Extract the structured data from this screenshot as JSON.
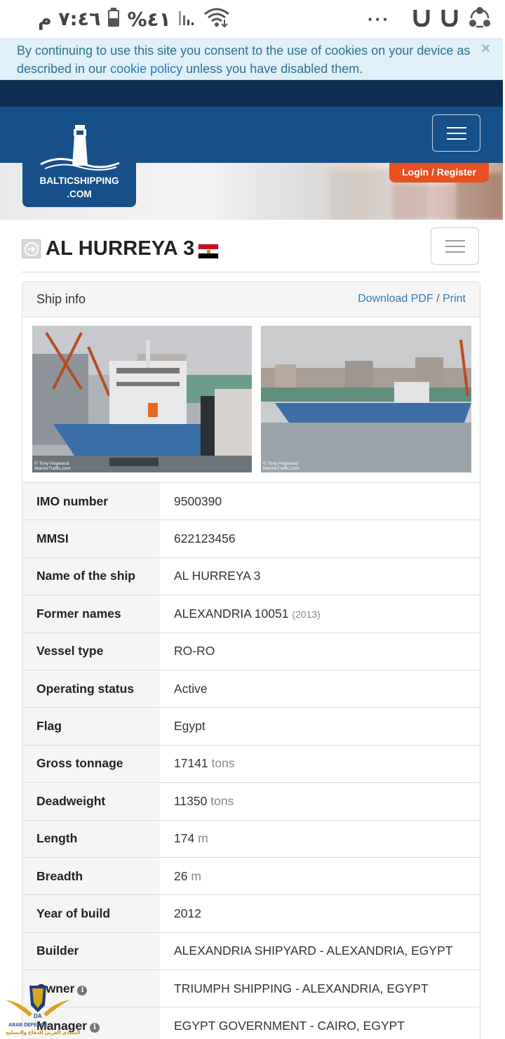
{
  "status_bar": {
    "time": "٧:٤٦ م",
    "battery": "%٤١",
    "dots": "···"
  },
  "cookie": {
    "text_before": "By continuing to use this site you consent to the use of cookies on your device as described in our ",
    "link": "cookie policy",
    "text_after": " unless you have disabled them.",
    "close": "×"
  },
  "brand": {
    "line1": "BALTICSHIPPING",
    "line2": ".COM"
  },
  "auth": {
    "login": "Login",
    "separator": "/",
    "register": "Register"
  },
  "page": {
    "title": "AL HURREYA 3",
    "flag_country": "Egypt"
  },
  "panel": {
    "title": "Ship info",
    "download_pdf": "Download PDF",
    "separator": "/",
    "print": "Print"
  },
  "photos": [
    {
      "credit_line1": "© Tony Hogwood",
      "credit_line2": "MarineTraffic.com"
    },
    {
      "credit_line1": "© Tony Hogwood",
      "credit_line2": "MarineTraffic.com"
    }
  ],
  "ship_info": {
    "imo": {
      "label": "IMO number",
      "value": "9500390"
    },
    "mmsi": {
      "label": "MMSI",
      "value": "622123456"
    },
    "name": {
      "label": "Name of the ship",
      "value": "AL HURREYA 3"
    },
    "former": {
      "label": "Former names",
      "value": "ALEXANDRIA 10051",
      "extra": "(2013)"
    },
    "type": {
      "label": "Vessel type",
      "value": "RO-RO"
    },
    "status": {
      "label": "Operating status",
      "value": "Active"
    },
    "flag": {
      "label": "Flag",
      "value": "Egypt"
    },
    "gross": {
      "label": "Gross tonnage",
      "value": "17141",
      "unit": "tons"
    },
    "dwt": {
      "label": "Deadweight",
      "value": "11350",
      "unit": "tons"
    },
    "length": {
      "label": "Length",
      "value": "174",
      "unit": "m"
    },
    "breadth": {
      "label": "Breadth",
      "value": "26",
      "unit": "m"
    },
    "year": {
      "label": "Year of build",
      "value": "2012"
    },
    "builder": {
      "label": "Builder",
      "value": "ALEXANDRIA SHIPYARD - ALEXANDRIA, EGYPT"
    },
    "owner": {
      "label": "Owner",
      "value": "TRIUMPH SHIPPING - ALEXANDRIA, EGYPT"
    },
    "manager": {
      "label": "Manager",
      "value": "EGYPT GOVERNMENT - CAIRO, EGYPT"
    }
  },
  "watermark": {
    "line1": "ARAB DEFENCE",
    "line2": "المنتدى العربي للدفاع والتسليح"
  },
  "colors": {
    "navbar": "#174f88",
    "top_band": "#0d2f52",
    "accent_orange": "#e8501f",
    "link_blue": "#337ab7",
    "cookie_bg": "#dff0f8"
  }
}
